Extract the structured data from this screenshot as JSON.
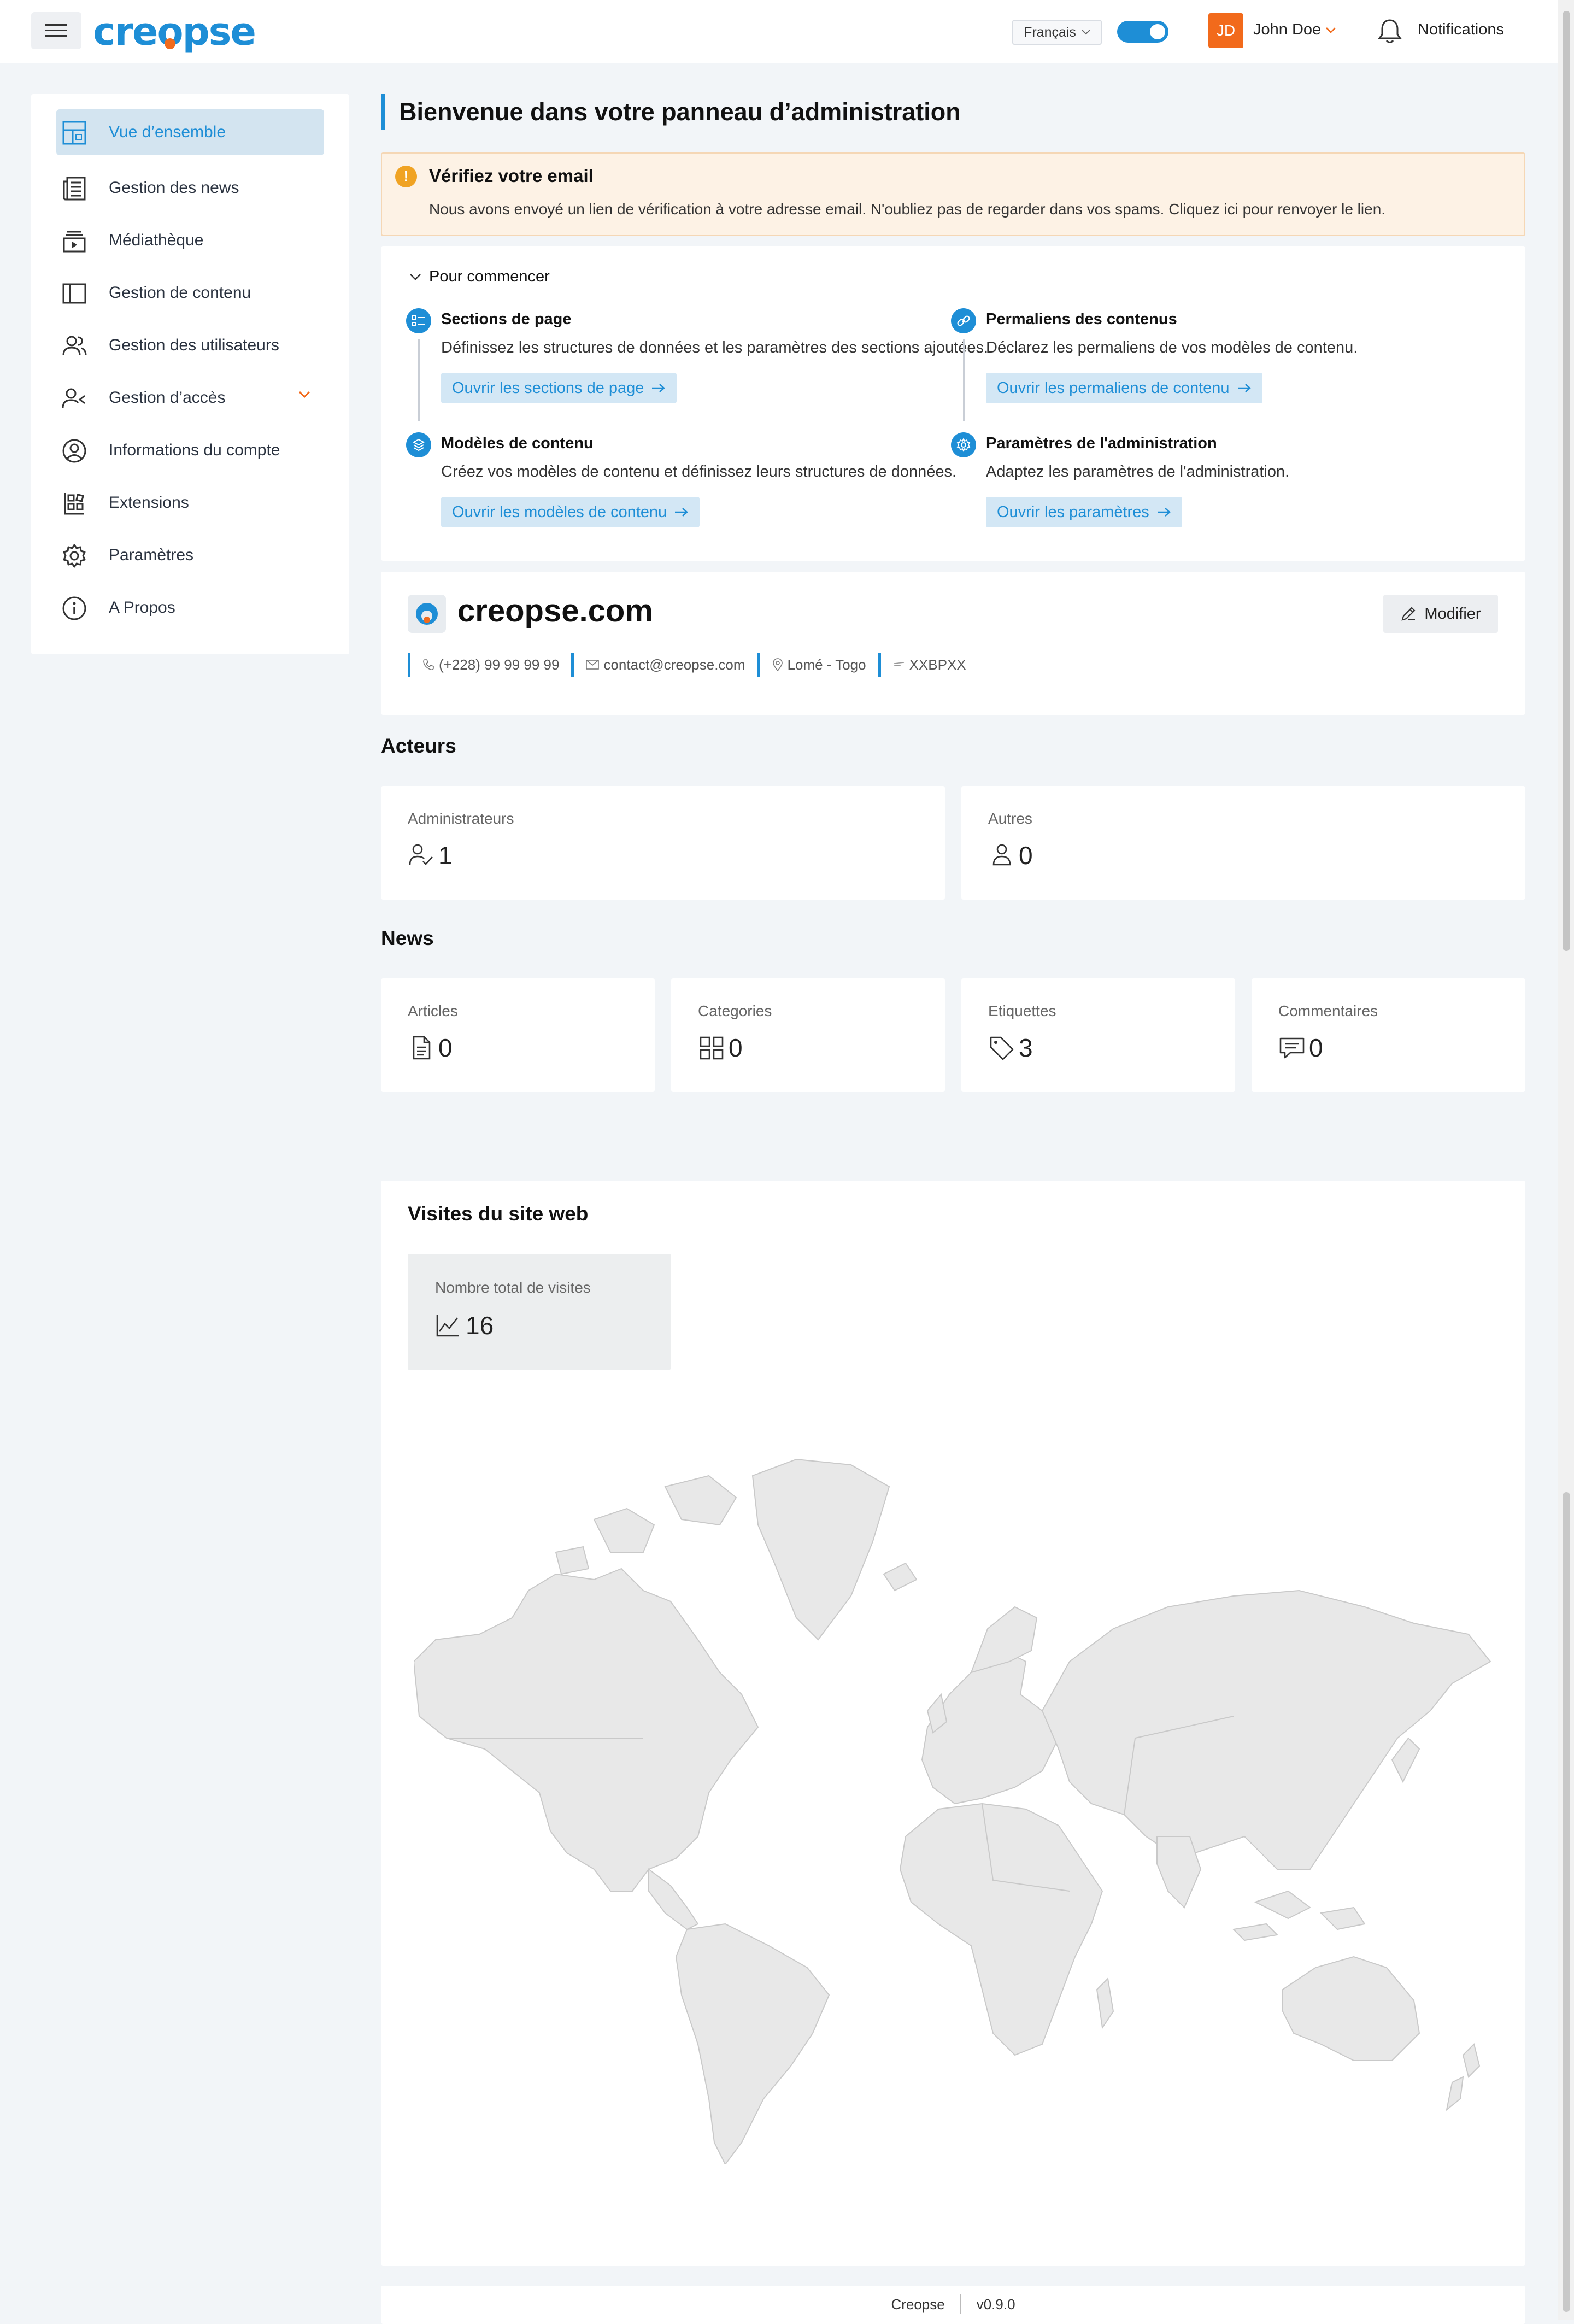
{
  "topbar": {
    "logo": {
      "prefix": "cre",
      "o": "o",
      "suffix": "pse"
    },
    "language": "Français",
    "user": {
      "initials": "JD",
      "name": "John Doe"
    },
    "notifications_label": "Notifications"
  },
  "sidebar": {
    "items": [
      {
        "label": "Vue d’ensemble",
        "icon": "dashboard-icon",
        "active": true
      },
      {
        "label": "Gestion des news",
        "icon": "newspaper-icon"
      },
      {
        "label": "Médiathèque",
        "icon": "media-icon"
      },
      {
        "label": "Gestion de contenu",
        "icon": "layout-icon"
      },
      {
        "label": "Gestion des utilisateurs",
        "icon": "users-icon"
      },
      {
        "label": "Gestion d’accès",
        "icon": "user-access-icon"
      },
      {
        "label": "Informations du compte",
        "icon": "account-icon"
      },
      {
        "label": "Extensions",
        "icon": "extensions-icon"
      },
      {
        "label": "Paramètres",
        "icon": "gear-icon"
      },
      {
        "label": "A Propos",
        "icon": "info-icon"
      }
    ]
  },
  "main": {
    "title": "Bienvenue dans votre panneau d’administration",
    "alert": {
      "title": "Vérifiez votre email",
      "text": "Nous avons envoyé un lien de vérification à votre adresse email. N'oubliez pas de regarder dans vos spams. Cliquez ici pour renvoyer le lien."
    },
    "getting_started": {
      "heading": "Pour commencer",
      "steps": [
        {
          "title": "Sections de page",
          "desc": "Définissez les structures de données et les paramètres des sections ajoutées.",
          "button": "Ouvrir les sections de page"
        },
        {
          "title": "Permaliens des contenus",
          "desc": "Déclarez les permaliens de vos modèles de contenu.",
          "button": "Ouvrir les permaliens de contenu"
        },
        {
          "title": "Modèles de contenu",
          "desc": "Créez vos modèles de contenu et définissez leurs structures de données.",
          "button": "Ouvrir les modèles de contenu"
        },
        {
          "title": "Paramètres de l'administration",
          "desc": "Adaptez les paramètres de l'administration.",
          "button": "Ouvrir les paramètres"
        }
      ]
    },
    "site": {
      "name": "creopse.com",
      "edit_label": "Modifier",
      "phone": "(+228) 99 99 99 99",
      "email": "contact@creopse.com",
      "location": "Lomé - Togo",
      "code": "XXBPXX"
    },
    "actors": {
      "heading": "Acteurs",
      "items": [
        {
          "label": "Administrateurs",
          "value": "1"
        },
        {
          "label": "Autres",
          "value": "0"
        }
      ]
    },
    "news": {
      "heading": "News",
      "items": [
        {
          "label": "Articles",
          "value": "0"
        },
        {
          "label": "Categories",
          "value": "0"
        },
        {
          "label": "Etiquettes",
          "value": "3"
        },
        {
          "label": "Commentaires",
          "value": "0"
        }
      ]
    },
    "visits": {
      "title": "Visites du site web",
      "total_label": "Nombre total de visites",
      "total_value": "16"
    }
  },
  "footer": {
    "brand": "Creopse",
    "version": "v0.9.0"
  },
  "colors": {
    "accent": "#1e8ed6",
    "brand_orange": "#f26a1b",
    "warning": "#f0a323"
  }
}
